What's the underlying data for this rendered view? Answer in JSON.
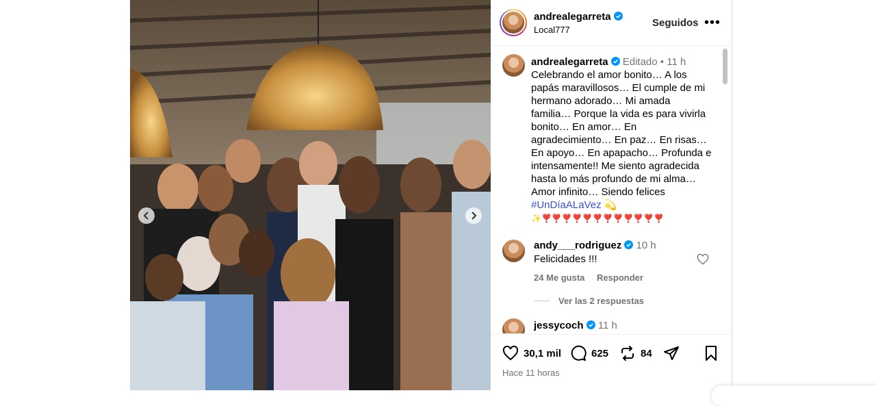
{
  "post": {
    "username": "andrealegarreta",
    "location": "Local777",
    "follow_label": "Seguidos",
    "more_label": "•••"
  },
  "caption": {
    "username": "andrealegarreta",
    "edited": "Editado",
    "separator": "•",
    "time": "11 h",
    "text": "Celebrando el amor bonito… A los papás maravillosos… El cumple de mi hermano adorado… Mi amada familia… Porque la vida es para vivirla bonito… En amor… En agradecimiento… En paz… En risas… En apoyo… En apapacho… Profunda e intensamente!! Me siento agradecida hasta lo más profundo de mi alma… Amor infinito… Siendo felices",
    "hashtag": "#UnDíaALaVez",
    "hashtag_emoji": "💫",
    "emojis": "✨❣️❣️❣️❣️❣️❣️❣️❣️❣️❣️❣️❣️"
  },
  "comments": [
    {
      "username": "andy___rodriguez",
      "time": "10 h",
      "text": "Felicidades !!!",
      "likes": "24 Me gusta",
      "reply_label": "Responder",
      "view_replies": "Ver las 2 respuestas"
    },
    {
      "username": "jessycoch",
      "time": "11 h"
    }
  ],
  "actions": {
    "likes": "30,1 mil",
    "comments": "625",
    "reposts": "84",
    "timestamp": "Hace 11 horas"
  },
  "colors": {
    "verified": "#0095f6",
    "muted": "#737373",
    "hashtag": "#3a4fd6",
    "border": "#dbdbdb"
  },
  "icons": [
    "verified-icon",
    "heart-icon",
    "comment-icon",
    "repost-icon",
    "share-icon",
    "bookmark-icon",
    "chevron-left-icon",
    "chevron-right-icon"
  ]
}
